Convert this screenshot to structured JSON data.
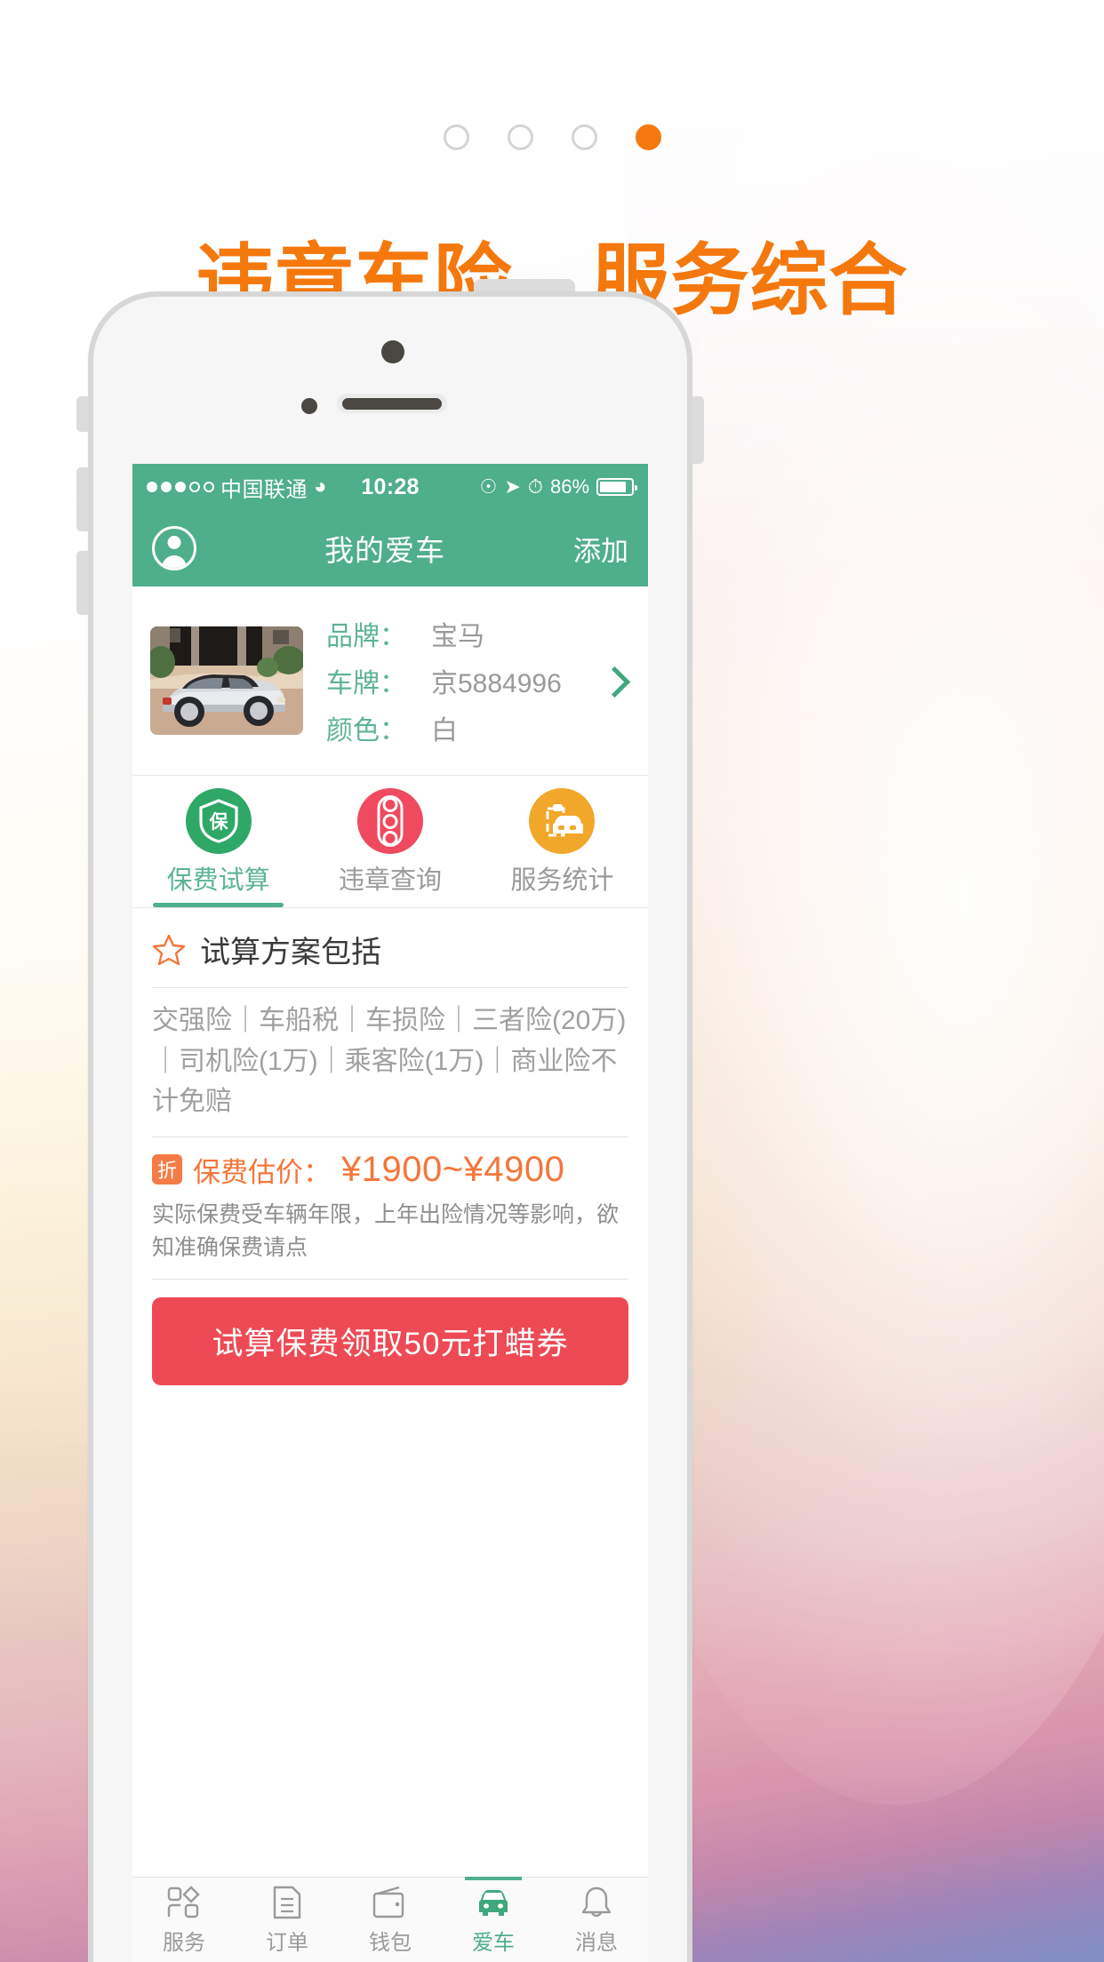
{
  "poster": {
    "headline": "违章车险，服务综合",
    "accent_color": "#f4780c",
    "dots": [
      {
        "active": false
      },
      {
        "active": false
      },
      {
        "active": false
      },
      {
        "active": true
      }
    ]
  },
  "status_bar": {
    "signal_dots_filled": 3,
    "signal_dots_empty": 2,
    "carrier": "中国联通",
    "wifi_icon": "wifi-icon",
    "time": "10:28",
    "lock_rotation_icon": "rotation-lock-icon",
    "location_icon": "location-arrow-icon",
    "alarm_icon": "alarm-clock-icon",
    "battery_percent": "86%",
    "battery_level": 86
  },
  "nav_bar": {
    "avatar_icon": "user-avatar-icon",
    "title": "我的爱车",
    "action_label": "添加",
    "background_color": "#4fae8c"
  },
  "car_card": {
    "photo_alt": "car-photo",
    "rows": [
      {
        "label": "品牌：",
        "value": "宝马"
      },
      {
        "label": "车牌：",
        "value": "京5884996"
      },
      {
        "label": "颜色：",
        "value": "白"
      }
    ],
    "chevron_icon": "chevron-right-icon",
    "label_color": "#5eb493"
  },
  "service_tabs": [
    {
      "label": "保费试算",
      "icon": "shield-bao-icon",
      "color": "#2fa866",
      "active": true
    },
    {
      "label": "违章查询",
      "icon": "traffic-light-icon",
      "color": "#ef4a5f",
      "active": false
    },
    {
      "label": "服务统计",
      "icon": "car-clipboard-icon",
      "color": "#f1a729",
      "active": false
    }
  ],
  "plan_section": {
    "star_icon": "star-outline-icon",
    "title": "试算方案包括",
    "coverage_text": "交强险｜车船税｜车损险｜三者险(20万)｜司机险(1万)｜乘客险(1万)｜商业险不计免赔",
    "price_badge": "折",
    "price_label": "保费估价：",
    "price_value": "¥1900~¥4900",
    "price_color": "#f4763a",
    "disclaimer": "实际保费受车辆年限，上年出险情况等影响，欲知准确保费请点"
  },
  "cta": {
    "label": "试算保费领取50元打蜡券",
    "color": "#ed4a55"
  },
  "tab_bar": [
    {
      "label": "服务",
      "icon": "services-grid-icon",
      "active": false
    },
    {
      "label": "订单",
      "icon": "order-document-icon",
      "active": false
    },
    {
      "label": "钱包",
      "icon": "wallet-icon",
      "active": false
    },
    {
      "label": "爱车",
      "icon": "car-icon",
      "active": true
    },
    {
      "label": "消息",
      "icon": "bell-icon",
      "active": false
    }
  ]
}
